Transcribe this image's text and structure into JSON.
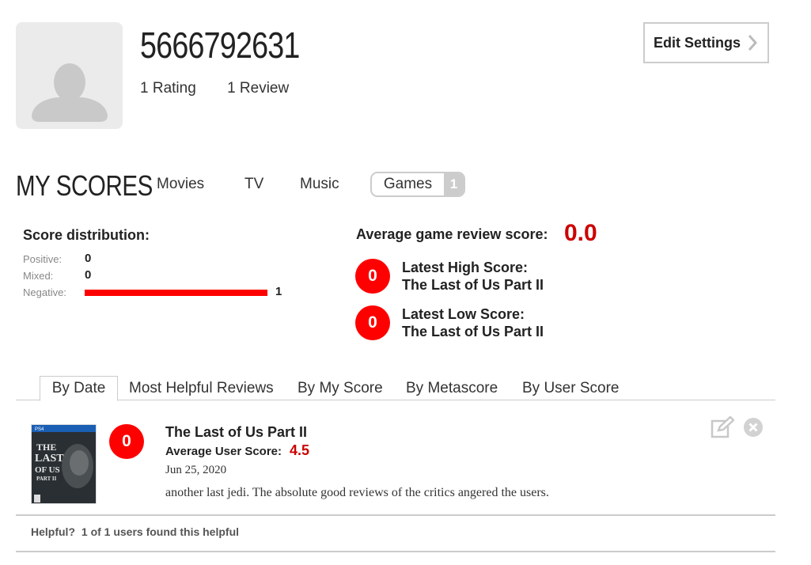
{
  "profile": {
    "username": "5666792631",
    "ratings": "1 Rating",
    "reviews": "1 Review",
    "edit_label": "Edit Settings"
  },
  "scores_nav": {
    "title": "MY SCORES",
    "movies": "Movies",
    "tv": "TV",
    "music": "Music",
    "games": "Games",
    "games_count": "1"
  },
  "distribution": {
    "title": "Score distribution:",
    "rows": [
      {
        "label": "Positive:",
        "value": "0",
        "count": 0
      },
      {
        "label": "Mixed:",
        "value": "0",
        "count": 0
      },
      {
        "label": "Negative:",
        "value": "1",
        "count": 1
      }
    ],
    "bar_color": "#ff0000"
  },
  "summary": {
    "avg_label": "Average game review score:",
    "avg_value": "0.0",
    "high_score": "0",
    "high_label": "Latest High Score:",
    "high_game": "The Last of Us Part II",
    "low_score": "0",
    "low_label": "Latest Low Score:",
    "low_game": "The Last of Us Part II"
  },
  "sort_tabs": {
    "by_date": "By Date",
    "most_helpful": "Most Helpful Reviews",
    "by_my_score": "By My Score",
    "by_metascore": "By Metascore",
    "by_user_score": "By User Score",
    "active": "By Date"
  },
  "review": {
    "score": "0",
    "game": "The Last of Us Part II",
    "avg_user_label": "Average User Score:",
    "avg_user_value": "4.5",
    "date": "Jun 25, 2020",
    "text": "another last jedi. The absolute good reviews of the critics angered the users.",
    "cover": {
      "platform": "PS4",
      "title_lines": [
        "THE",
        "LAST",
        "OF US",
        "PART II"
      ]
    },
    "helpful_label": "Helpful?",
    "helpful_count": "1 of 1 users found this helpful"
  },
  "colors": {
    "accent_red": "#ff0000",
    "score_red": "#cc0000",
    "border_gray": "#cccccc"
  }
}
